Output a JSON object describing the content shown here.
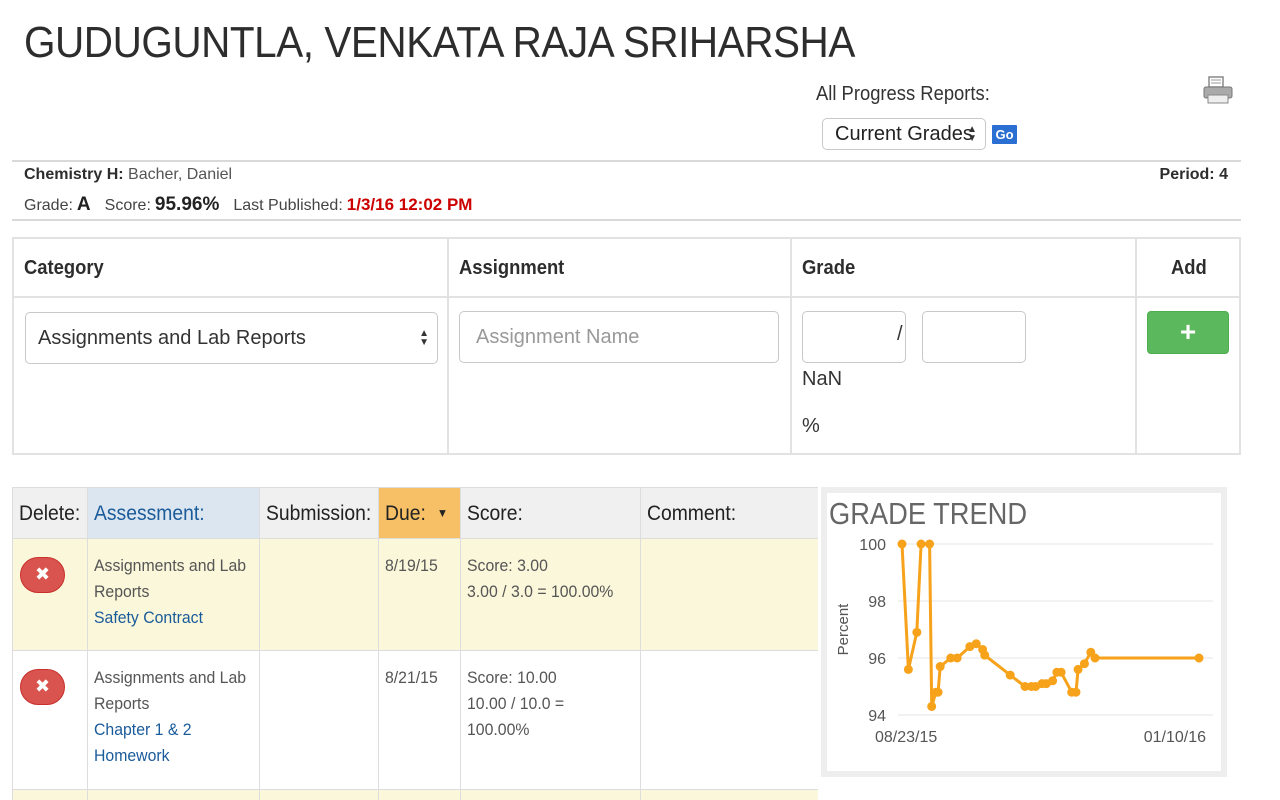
{
  "student": {
    "name": "GUDUGUNTLA, VENKATA RAJA SRIHARSHA"
  },
  "reports": {
    "label": "All Progress Reports:",
    "selected": "Current Grades",
    "go_label": "Go"
  },
  "class_info": {
    "course_label": "Chemistry H:",
    "teacher": "Bacher, Daniel",
    "period_label": "Period:",
    "period": "4",
    "grade_label": "Grade:",
    "grade": "A",
    "score_label": "Score:",
    "score": "95.96%",
    "published_label": "Last Published:",
    "published": "1/3/16 12:02 PM"
  },
  "add_form": {
    "headers": {
      "category": "Category",
      "assignment": "Assignment",
      "grade": "Grade",
      "add": "Add"
    },
    "category_value": "Assignments and Lab Reports",
    "assignment_placeholder": "Assignment Name",
    "points_earned": "",
    "points_possible": "",
    "slash": "/",
    "computed": "NaN",
    "percent_sign": "%",
    "add_icon": "plus-icon"
  },
  "assessments": {
    "headers": {
      "delete": "Delete:",
      "assessment": "Assessment:",
      "submission": "Submission:",
      "due": "Due:",
      "score": "Score:",
      "comment": "Comment:"
    },
    "rows": [
      {
        "category": "Assignments and Lab Reports",
        "name": "Safety Contract",
        "submission": "",
        "due": "8/19/15",
        "score": "Score: 3.00",
        "calc": "3.00 / 3.0 = 100.00%",
        "comment": ""
      },
      {
        "category": "Assignments and Lab Reports",
        "name": "Chapter 1 & 2 Homework",
        "submission": "",
        "due": "8/21/15",
        "score": "Score: 10.00",
        "calc": "10.00 / 10.0 = 100.00%",
        "comment": ""
      }
    ]
  },
  "trend": {
    "title": "GRADE TREND",
    "ylabel": "Percent",
    "x_start_label": "08/23/15",
    "x_end_label": "01/10/16"
  },
  "chart_data": {
    "type": "line",
    "title": "GRADE TREND",
    "ylabel": "Percent",
    "xlabel": "",
    "ylim": [
      94,
      100
    ],
    "yticks": [
      100,
      98,
      96,
      94
    ],
    "xtick_labels": [
      "08/23/15",
      "01/10/16"
    ],
    "line_color": "#f7a21b",
    "points": [
      {
        "x": "08/23/15",
        "y": 100.0
      },
      {
        "x": "08/26/15",
        "y": 95.6
      },
      {
        "x": "08/30/15",
        "y": 96.9
      },
      {
        "x": "09/01/15",
        "y": 100.0
      },
      {
        "x": "09/05/15",
        "y": 100.0
      },
      {
        "x": "09/06/15",
        "y": 94.3
      },
      {
        "x": "09/08/15",
        "y": 94.8
      },
      {
        "x": "09/09/15",
        "y": 94.8
      },
      {
        "x": "09/10/15",
        "y": 95.7
      },
      {
        "x": "09/15/15",
        "y": 96.0
      },
      {
        "x": "09/18/15",
        "y": 96.0
      },
      {
        "x": "09/24/15",
        "y": 96.4
      },
      {
        "x": "09/27/15",
        "y": 96.5
      },
      {
        "x": "09/30/15",
        "y": 96.3
      },
      {
        "x": "10/01/15",
        "y": 96.1
      },
      {
        "x": "10/13/15",
        "y": 95.4
      },
      {
        "x": "10/20/15",
        "y": 95.0
      },
      {
        "x": "10/23/15",
        "y": 95.0
      },
      {
        "x": "10/25/15",
        "y": 95.0
      },
      {
        "x": "10/28/15",
        "y": 95.1
      },
      {
        "x": "10/30/15",
        "y": 95.1
      },
      {
        "x": "11/02/15",
        "y": 95.2
      },
      {
        "x": "11/04/15",
        "y": 95.5
      },
      {
        "x": "11/06/15",
        "y": 95.5
      },
      {
        "x": "11/11/15",
        "y": 94.8
      },
      {
        "x": "11/13/15",
        "y": 94.8
      },
      {
        "x": "11/14/15",
        "y": 95.6
      },
      {
        "x": "11/17/15",
        "y": 95.8
      },
      {
        "x": "11/20/15",
        "y": 96.2
      },
      {
        "x": "11/22/15",
        "y": 96.0
      },
      {
        "x": "01/10/16",
        "y": 96.0
      }
    ]
  }
}
